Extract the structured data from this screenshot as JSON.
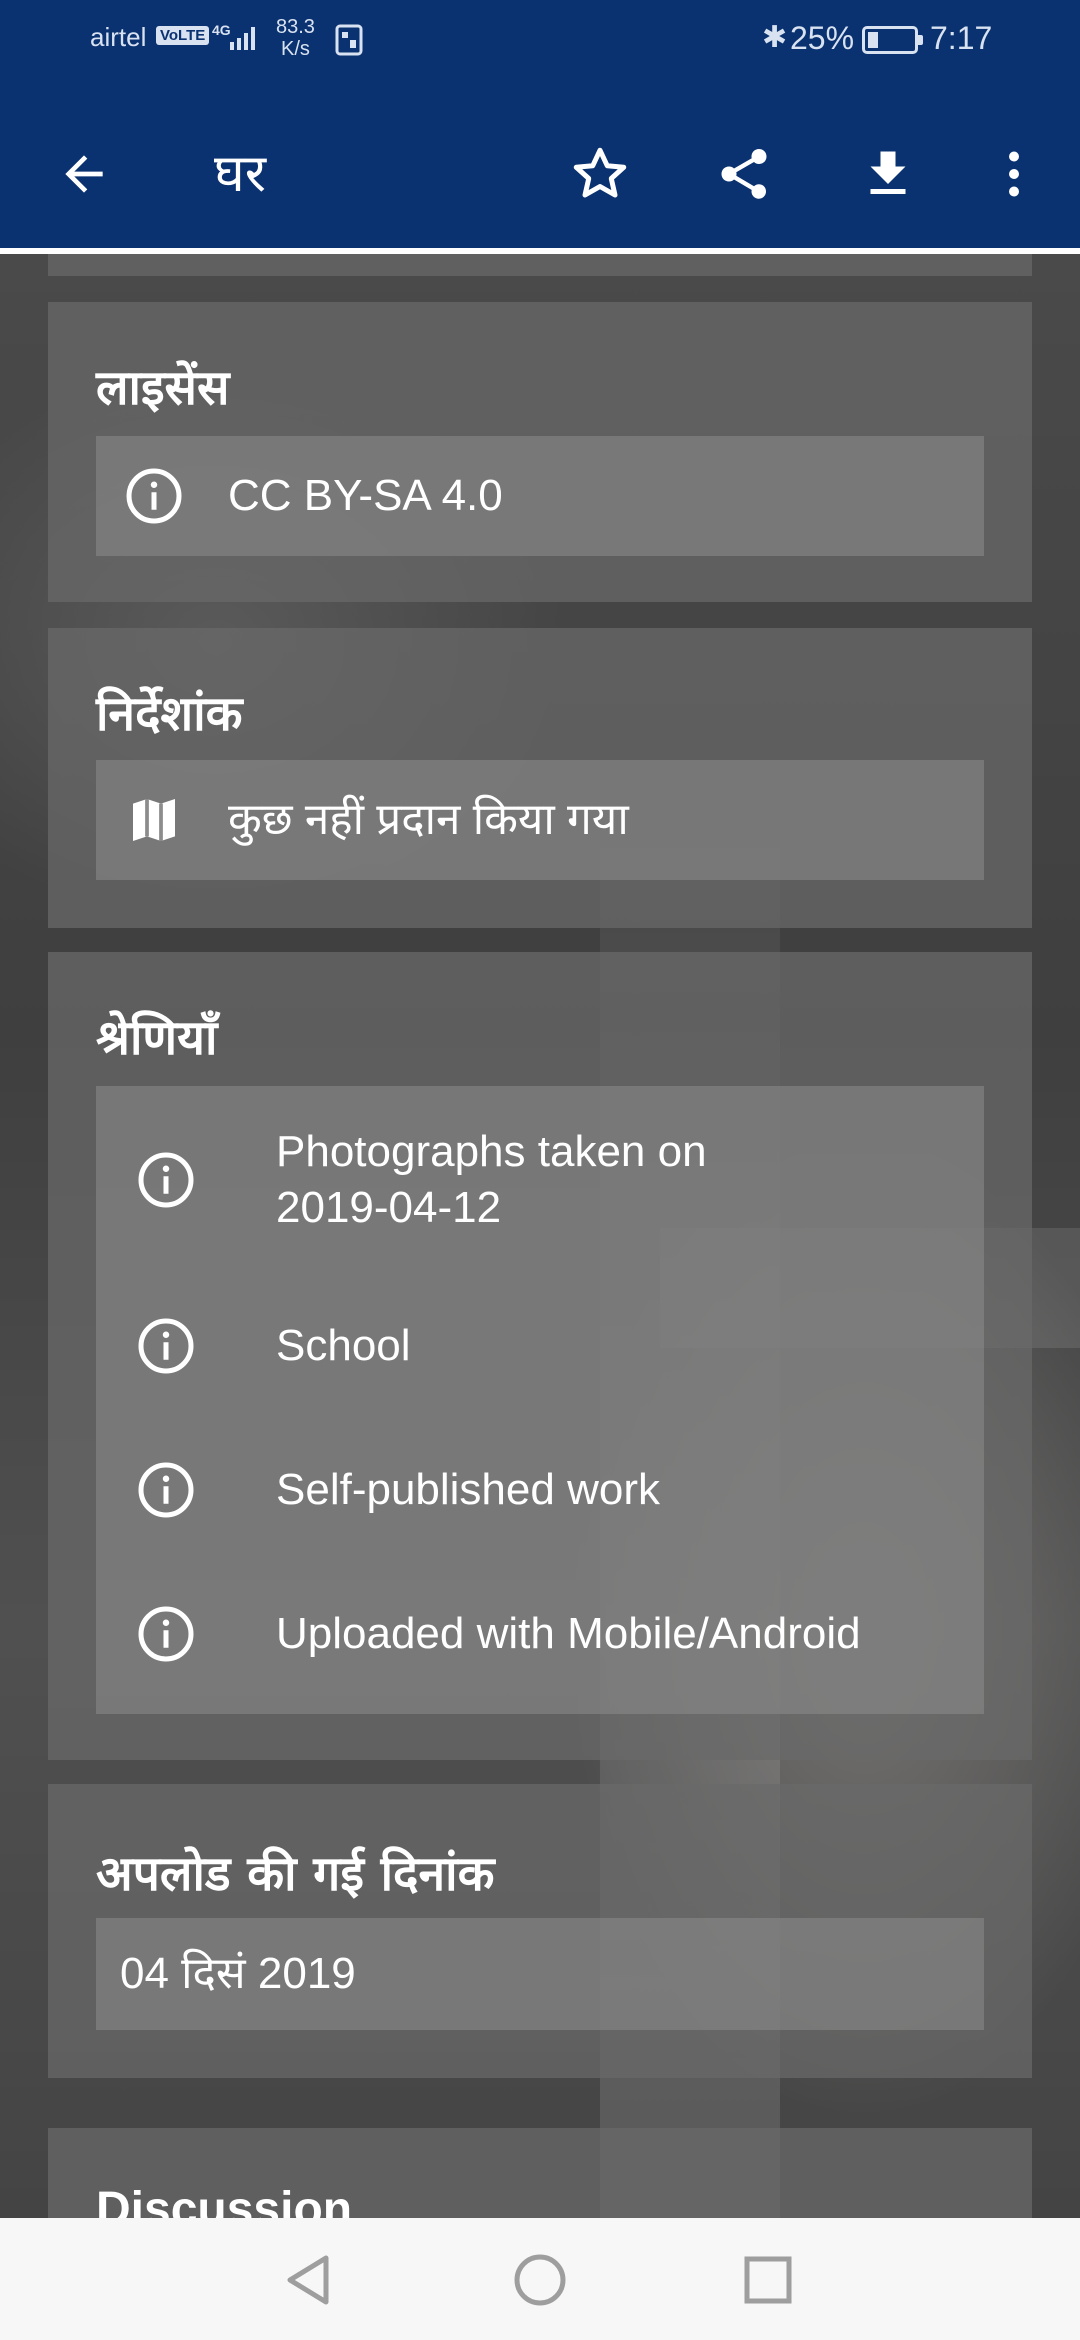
{
  "status_bar": {
    "carrier": "airtel",
    "volte": "VoLTE",
    "network": "4G",
    "speed_value": "83.3",
    "speed_unit": "K/s",
    "battery_percent": "25%",
    "time": "7:17"
  },
  "app_bar": {
    "title": "घर",
    "icons": [
      "back-arrow-icon",
      "star-icon",
      "share-icon",
      "download-icon",
      "more-vert-icon"
    ]
  },
  "sections": {
    "license": {
      "title": "लाइसेंस",
      "value": "CC BY-SA 4.0",
      "icon": "info-icon"
    },
    "coordinates": {
      "title": "निर्देशांक",
      "value": "कुछ नहीं प्रदान किया गया",
      "icon": "map-icon"
    },
    "categories": {
      "title": "श्रेणियाँ",
      "items": [
        {
          "line1": "Photographs taken on",
          "line2": "2019-04-12"
        },
        {
          "line1": "School"
        },
        {
          "line1": "Self-published work"
        },
        {
          "line1": "Uploaded with Mobile/Android"
        }
      ]
    },
    "upload_date": {
      "title": "अपलोड की गई दिनांक",
      "value": "04 दिसं 2019"
    },
    "discussion": {
      "title": "Discussion"
    }
  },
  "colors": {
    "app_bar": "#0a3170",
    "card": "#696969",
    "inner": "#8c8c8c",
    "navbar": "#f7f7f7"
  }
}
